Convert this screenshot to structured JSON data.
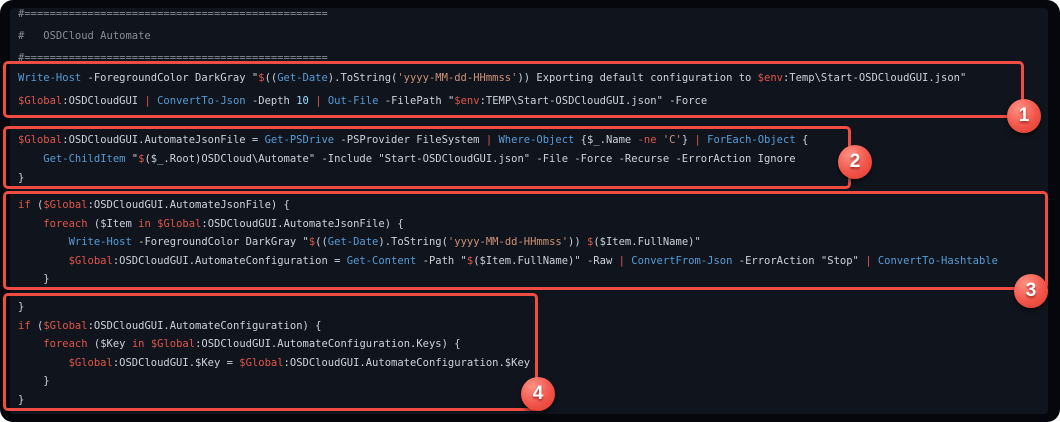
{
  "colors": {
    "page_bg": "#ffffff",
    "window_bg": "#05070d",
    "surface_bg": "#10141d",
    "box_border": "#f14c44",
    "comment": "#848d97",
    "text": "#ccd2dc",
    "cmdlet": "#569cd6",
    "keyword": "#e0564a",
    "string": "#ce9178",
    "number": "#9cdcfe"
  },
  "comment_lines": [
    [
      [
        "c",
        "#================================================"
      ]
    ],
    [
      [
        "c",
        "#   OSDCloud Automate"
      ]
    ],
    [
      [
        "c",
        "#================================================"
      ]
    ]
  ],
  "annotation_boxes": [
    {
      "badge": "1",
      "lines": [
        [
          [
            "b",
            "Write-Host"
          ],
          [
            "d",
            " -ForegroundColor DarkGray \""
          ],
          [
            "r",
            "$"
          ],
          [
            "d",
            "(("
          ],
          [
            "b",
            "Get-Date"
          ],
          [
            "d",
            ").ToString("
          ],
          [
            "s",
            "'yyyy-MM-dd-HHmmss'"
          ],
          [
            "d",
            ")) Exporting default configuration to "
          ],
          [
            "r",
            "$env"
          ],
          [
            "d",
            ":Temp\\Start-OSDCloudGUI.json\""
          ]
        ],
        [
          [
            "r",
            "$Global"
          ],
          [
            "d",
            ":OSDCloudGUI "
          ],
          [
            "r",
            "|"
          ],
          [
            "d",
            " "
          ],
          [
            "b",
            "ConvertTo-Json"
          ],
          [
            "d",
            " -Depth "
          ],
          [
            "n",
            "10"
          ],
          [
            "d",
            " "
          ],
          [
            "r",
            "|"
          ],
          [
            "d",
            " "
          ],
          [
            "b",
            "Out-File"
          ],
          [
            "d",
            " -FilePath \""
          ],
          [
            "r",
            "$env"
          ],
          [
            "d",
            ":TEMP\\Start-OSDCloudGUI.json\" -Force"
          ]
        ]
      ]
    },
    {
      "badge": "2",
      "lines": [
        [
          [
            "r",
            "$Global"
          ],
          [
            "d",
            ":OSDCloudGUI.AutomateJsonFile = "
          ],
          [
            "b",
            "Get-PSDrive"
          ],
          [
            "d",
            " -PSProvider FileSystem "
          ],
          [
            "r",
            "|"
          ],
          [
            "d",
            " "
          ],
          [
            "b",
            "Where-Object"
          ],
          [
            "d",
            " {$_.Name "
          ],
          [
            "r",
            "-ne"
          ],
          [
            "d",
            " "
          ],
          [
            "s",
            "'C'"
          ],
          [
            "d",
            "} "
          ],
          [
            "r",
            "|"
          ],
          [
            "d",
            " "
          ],
          [
            "b",
            "ForEach-Object"
          ],
          [
            "d",
            " {"
          ]
        ],
        [
          [
            "d",
            "    "
          ],
          [
            "b",
            "Get-ChildItem"
          ],
          [
            "d",
            " \""
          ],
          [
            "r",
            "$"
          ],
          [
            "d",
            "($_.Root)OSDCloud\\Automate\" -Include \"Start-OSDCloudGUI.json\" -File -Force -Recurse -ErrorAction Ignore"
          ]
        ],
        [
          [
            "d",
            "}"
          ]
        ]
      ]
    },
    {
      "badge": "3",
      "lines": [
        [
          [
            "r",
            "if"
          ],
          [
            "d",
            " ("
          ],
          [
            "r",
            "$Global"
          ],
          [
            "d",
            ":OSDCloudGUI.AutomateJsonFile) {"
          ]
        ],
        [
          [
            "d",
            "    "
          ],
          [
            "r",
            "foreach"
          ],
          [
            "d",
            " ($Item "
          ],
          [
            "r",
            "in"
          ],
          [
            "d",
            " "
          ],
          [
            "r",
            "$Global"
          ],
          [
            "d",
            ":OSDCloudGUI.AutomateJsonFile) {"
          ]
        ],
        [
          [
            "d",
            "        "
          ],
          [
            "b",
            "Write-Host"
          ],
          [
            "d",
            " -ForegroundColor DarkGray \""
          ],
          [
            "r",
            "$"
          ],
          [
            "d",
            "(("
          ],
          [
            "b",
            "Get-Date"
          ],
          [
            "d",
            ").ToString("
          ],
          [
            "s",
            "'yyyy-MM-dd-HHmmss'"
          ],
          [
            "d",
            ")) "
          ],
          [
            "r",
            "$"
          ],
          [
            "d",
            "($Item.FullName)\""
          ]
        ],
        [
          [
            "d",
            "        "
          ],
          [
            "r",
            "$Global"
          ],
          [
            "d",
            ":OSDCloudGUI.AutomateConfiguration = "
          ],
          [
            "b",
            "Get-Content"
          ],
          [
            "d",
            " -Path \""
          ],
          [
            "r",
            "$"
          ],
          [
            "d",
            "($Item.FullName)\" -Raw "
          ],
          [
            "r",
            "|"
          ],
          [
            "d",
            " "
          ],
          [
            "b",
            "ConvertFrom-Json"
          ],
          [
            "d",
            " -ErrorAction \"Stop\" "
          ],
          [
            "r",
            "|"
          ],
          [
            "d",
            " "
          ],
          [
            "b",
            "ConvertTo-Hashtable"
          ]
        ],
        [
          [
            "d",
            "    }"
          ]
        ]
      ]
    },
    {
      "badge": "4",
      "lines": [
        [
          [
            "d",
            "}"
          ]
        ],
        [
          [
            "r",
            "if"
          ],
          [
            "d",
            " ("
          ],
          [
            "r",
            "$Global"
          ],
          [
            "d",
            ":OSDCloudGUI.AutomateConfiguration) {"
          ]
        ],
        [
          [
            "d",
            "    "
          ],
          [
            "r",
            "foreach"
          ],
          [
            "d",
            " ($Key "
          ],
          [
            "r",
            "in"
          ],
          [
            "d",
            " "
          ],
          [
            "r",
            "$Global"
          ],
          [
            "d",
            ":OSDCloudGUI.AutomateConfiguration.Keys) {"
          ]
        ],
        [
          [
            "d",
            "        "
          ],
          [
            "r",
            "$Global"
          ],
          [
            "d",
            ":OSDCloudGUI.$Key = "
          ],
          [
            "r",
            "$Global"
          ],
          [
            "d",
            ":OSDCloudGUI.AutomateConfiguration.$Key"
          ]
        ],
        [
          [
            "d",
            "    }"
          ]
        ],
        [
          [
            "d",
            "}"
          ]
        ]
      ]
    }
  ]
}
